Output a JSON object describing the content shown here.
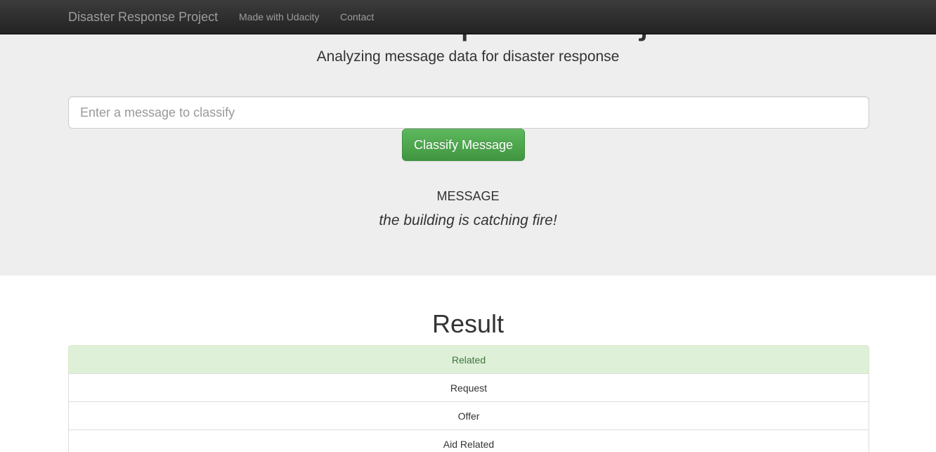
{
  "navbar": {
    "brand": "Disaster Response Project",
    "links": [
      "Made with Udacity",
      "Contact"
    ]
  },
  "jumbotron": {
    "title": "Disaster Response Project",
    "subtitle": "Analyzing message data for disaster response",
    "input_placeholder": "Enter a message to classify",
    "input_value": "",
    "button_label": "Classify Message",
    "message_label": "MESSAGE",
    "message_text": "the building is catching fire!"
  },
  "result": {
    "title": "Result",
    "categories": [
      {
        "label": "Related",
        "positive": true
      },
      {
        "label": "Request",
        "positive": false
      },
      {
        "label": "Offer",
        "positive": false
      },
      {
        "label": "Aid Related",
        "positive": false
      }
    ]
  },
  "colors": {
    "positive_bg": "#dff0d8",
    "positive_text": "#3c763d",
    "button": "#5cb85c",
    "navbar": "#222222"
  }
}
